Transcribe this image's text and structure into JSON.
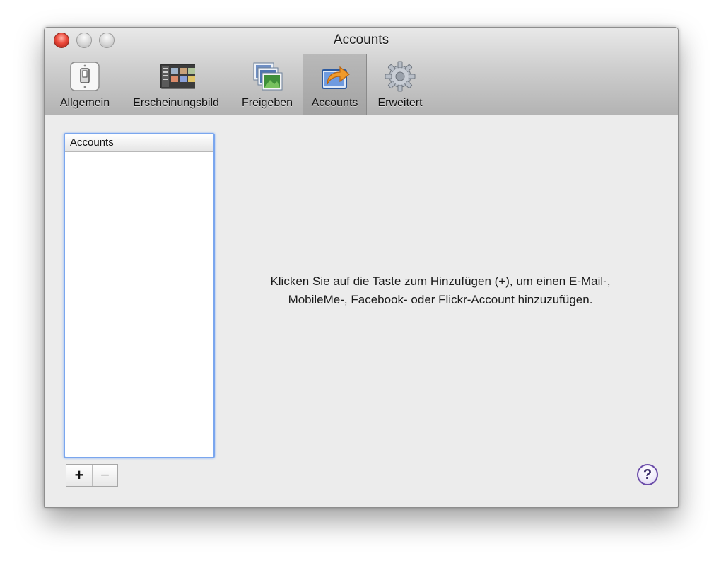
{
  "window": {
    "title": "Accounts"
  },
  "toolbar": {
    "items": [
      {
        "label": "Allgemein",
        "icon": "light-switch-icon",
        "selected": false
      },
      {
        "label": "Erscheinungsbild",
        "icon": "appearance-panel-icon",
        "selected": false
      },
      {
        "label": "Freigeben",
        "icon": "stacked-photos-icon",
        "selected": false
      },
      {
        "label": "Accounts",
        "icon": "share-arrow-icon",
        "selected": true
      },
      {
        "label": "Erweitert",
        "icon": "gear-icon",
        "selected": false
      }
    ]
  },
  "accounts_list": {
    "header": "Accounts",
    "add_label": "+",
    "remove_label": "−"
  },
  "main": {
    "hint_line1": "Klicken Sie auf die Taste zum Hinzufügen (+), um einen E-Mail-,",
    "hint_line2": "MobileMe-, Facebook- oder Flickr-Account hinzuzufügen."
  },
  "help": {
    "label": "?"
  },
  "colors": {
    "focus_ring": "#7aa6ee",
    "close_button": "#ec4a3c",
    "help_ring": "#6a4ba8"
  }
}
